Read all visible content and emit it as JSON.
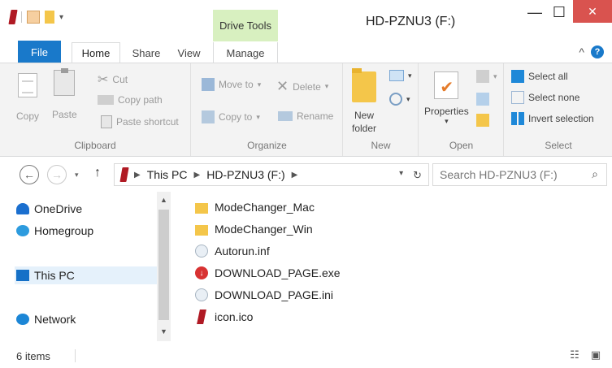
{
  "window": {
    "title": "HD-PZNU3 (F:)",
    "context_tab_header": "Drive Tools",
    "minimize_glyph": "—",
    "maximize_glyph": "☐",
    "close_glyph": "✕"
  },
  "tabs": {
    "file": "File",
    "home": "Home",
    "share": "Share",
    "view": "View",
    "manage": "Manage",
    "collapse_glyph": "^",
    "help_glyph": "?"
  },
  "ribbon": {
    "clipboard": {
      "label": "Clipboard",
      "copy": "Copy",
      "paste": "Paste",
      "cut": "Cut",
      "copy_path": "Copy path",
      "paste_shortcut": "Paste shortcut"
    },
    "organize": {
      "label": "Organize",
      "move_to": "Move to",
      "delete": "Delete",
      "copy_to": "Copy to",
      "rename": "Rename"
    },
    "new": {
      "label": "New",
      "new_folder_line1": "New",
      "new_folder_line2": "folder"
    },
    "open": {
      "label": "Open",
      "properties": "Properties"
    },
    "select": {
      "label": "Select",
      "select_all": "Select all",
      "select_none": "Select none",
      "invert_selection": "Invert selection"
    }
  },
  "navigation": {
    "back_glyph": "←",
    "forward_glyph": "→",
    "up_glyph": "↑",
    "breadcrumb": [
      "This PC",
      "HD-PZNU3 (F:)"
    ],
    "search_placeholder": "Search HD-PZNU3 (F:)"
  },
  "nav_pane": {
    "items": [
      "OneDrive",
      "Homegroup",
      "This PC",
      "Network"
    ],
    "selected": "This PC"
  },
  "files": [
    {
      "name": "ModeChanger_Mac",
      "icon": "folder-icon"
    },
    {
      "name": "ModeChanger_Win",
      "icon": "folder-icon"
    },
    {
      "name": "Autorun.inf",
      "icon": "settings-file-icon"
    },
    {
      "name": "DOWNLOAD_PAGE.exe",
      "icon": "download-exe-icon"
    },
    {
      "name": "DOWNLOAD_PAGE.ini",
      "icon": "settings-file-icon"
    },
    {
      "name": "icon.ico",
      "icon": "drive-ico-icon"
    }
  ],
  "status": {
    "item_count": "6 items"
  },
  "colors": {
    "file_tab": "#1979ca",
    "drive_tools": "#d8f0c0",
    "close_button": "#d9534f"
  }
}
